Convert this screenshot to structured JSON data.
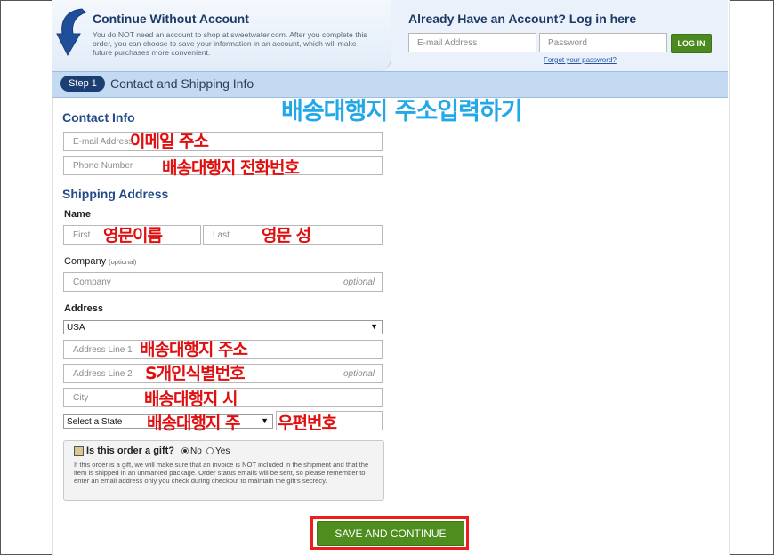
{
  "guest": {
    "title": "Continue Without Account",
    "text": "You do NOT need an account to shop at sweetwater.com. After you complete this order, you can choose to save your information in an account, which will make future purchases more convenient."
  },
  "login": {
    "title": "Already Have an Account? Log in here",
    "email_placeholder": "E-mail Address",
    "password_placeholder": "Password",
    "button": "LOG IN",
    "forgot": "Forgot your password?"
  },
  "step": {
    "badge": "Step 1",
    "title": "Contact and Shipping Info"
  },
  "contact": {
    "title": "Contact Info",
    "email_placeholder": "E-mail Address",
    "phone_placeholder": "Phone Number"
  },
  "shipping": {
    "title": "Shipping Address",
    "name_label": "Name",
    "first_placeholder": "First",
    "last_placeholder": "Last",
    "company_label": "Company",
    "company_optional": "(optional)",
    "company_placeholder": "Company",
    "optional": "optional",
    "address_label": "Address",
    "country": "USA",
    "address1_placeholder": "Address Line 1",
    "address2_placeholder": "Address Line 2",
    "city_placeholder": "City",
    "state": "Select a State"
  },
  "gift": {
    "question": "Is this order a gift?",
    "no": "No",
    "yes": "Yes",
    "selected": "No",
    "text": "If this order is a gift, we will make sure that an invoice is NOT included in the shipment and that the item is shipped in an unmarked package. Order status emails will be sent, so please remember to enter an email address only you check during checkout to maintain the gift's secrecy."
  },
  "save_button": "SAVE AND CONTINUE",
  "annotations": {
    "heading": "배송대행지 주소입력하기",
    "email": "이메일 주소",
    "phone": "배송대행지 전화번호",
    "first": "영문이름",
    "last": "영문 성",
    "address1": "배송대행지 주소",
    "address2": "S개인식별번호",
    "city": "배송대행지 시",
    "state": "배송대행지 주",
    "zip": "우편번호"
  },
  "colors": {
    "accent_blue": "#234a86",
    "step_bar": "#c4daf2",
    "button_green": "#4e8e1f",
    "annotation_red": "#e01010",
    "annotation_blue": "#22a7e8",
    "highlight_box": "#ee1c1c"
  }
}
